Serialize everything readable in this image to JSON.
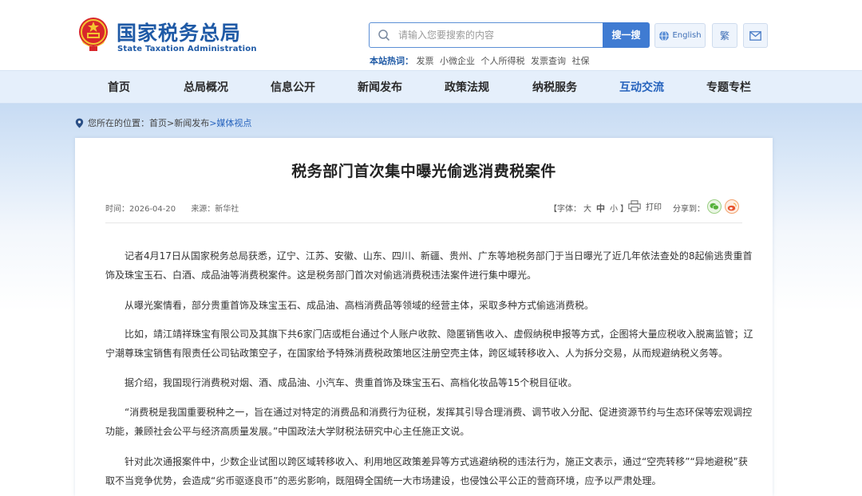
{
  "header": {
    "logo_cn": "国家税务总局",
    "logo_en": "State Taxation Administration",
    "search": {
      "placeholder": "请输入您要搜索的内容",
      "button": "搜一搜"
    },
    "hot_label": "本站热词：",
    "hot_words": [
      "发票",
      "小微企业",
      "个人所得税",
      "发票查询",
      "社保"
    ],
    "tools": {
      "english": "English",
      "traditional": "繁"
    }
  },
  "nav": {
    "items": [
      "首页",
      "总局概况",
      "信息公开",
      "新闻发布",
      "政策法规",
      "纳税服务",
      "互动交流",
      "专题专栏"
    ],
    "active_index": 6
  },
  "breadcrumb": {
    "prefix": "您所在的位置：",
    "links": [
      "首页",
      ">新闻发布",
      ">媒体视点"
    ]
  },
  "article": {
    "title": "税务部门首次集中曝光偷逃消费税案件",
    "time": "时间：2026-04-20",
    "source": "来源：新华社",
    "font_ctrl": {
      "prefix": "【字体：",
      "large": "大",
      "medium": "中",
      "small": "小",
      "suffix": "】"
    },
    "print": "打印",
    "share": "分享到：",
    "paragraphs": [
      "记者4月17日从国家税务总局获悉，辽宁、江苏、安徽、山东、四川、新疆、贵州、广东等地税务部门于当日曝光了近几年依法查处的8起偷逃贵重首饰及珠宝玉石、白酒、成品油等消费税案件。这是税务部门首次对偷逃消费税违法案件进行集中曝光。",
      "从曝光案情看，部分贵重首饰及珠宝玉石、成品油、高档消费品等领域的经营主体，采取多种方式偷逃消费税。",
      "比如，靖江靖祥珠宝有限公司及其旗下共6家门店或柜台通过个人账户收款、隐匿销售收入、虚假纳税申报等方式，企图将大量应税收入脱离监管；辽宁潮尊珠宝销售有限责任公司钻政策空子，在国家给予特殊消费税政策地区注册空壳主体，跨区域转移收入、人为拆分交易，从而规避纳税义务等。",
      "据介绍，我国现行消费税对烟、酒、成品油、小汽车、贵重首饰及珠宝玉石、高档化妆品等15个税目征收。",
      "“消费税是我国重要税种之一，旨在通过对特定的消费品和消费行为征税，发挥其引导合理消费、调节收入分配、促进资源节约与生态环保等宏观调控功能，兼顾社会公平与经济高质量发展。”中国政法大学财税法研究中心主任施正文说。",
      "针对此次通报案件中，少数企业试图以跨区域转移收入、利用地区政策差异等方式逃避纳税的违法行为，施正文表示，通过“空壳转移”“异地避税”获取不当竞争优势，会造成“劣币驱逐良币”的恶劣影响，既阻碍全国统一大市场建设，也侵蚀公平公正的营商环境，应予以严肃处理。"
    ]
  },
  "colors": {
    "brand_blue": "#1f5aa6",
    "accent_blue": "#3f7bd2",
    "nav_bg": "#e5effb",
    "active_nav": "#2663bd"
  },
  "icons": [
    "national-emblem-icon",
    "search-icon",
    "globe-icon",
    "mail-icon",
    "location-pin-icon",
    "printer-icon",
    "wechat-icon",
    "weibo-icon"
  ]
}
